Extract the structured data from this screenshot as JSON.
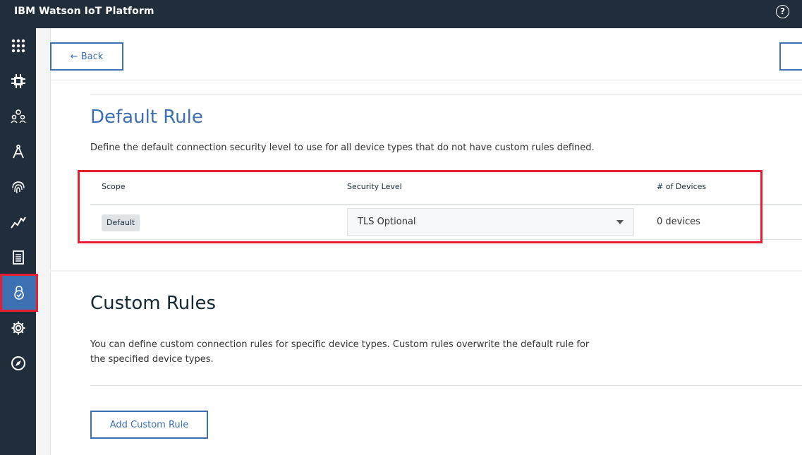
{
  "app": {
    "title": "IBM Watson IoT Platform",
    "help_icon": "help-circle-icon"
  },
  "sidebar": {
    "items": [
      {
        "name": "apps-grid",
        "icon": "grid-icon",
        "active": false
      },
      {
        "name": "devices",
        "icon": "chip-icon",
        "active": false
      },
      {
        "name": "members",
        "icon": "members-icon",
        "active": false
      },
      {
        "name": "rules",
        "icon": "compass-draw-icon",
        "active": false
      },
      {
        "name": "identity",
        "icon": "fingerprint-icon",
        "active": false
      },
      {
        "name": "usage",
        "icon": "chart-line-icon",
        "active": false
      },
      {
        "name": "logs",
        "icon": "document-icon",
        "active": false
      },
      {
        "name": "security",
        "icon": "security-lock-icon",
        "active": true
      },
      {
        "name": "settings",
        "icon": "gear-icon",
        "active": false
      },
      {
        "name": "explore",
        "icon": "compass-icon",
        "active": false
      }
    ]
  },
  "toolbar": {
    "back_label": "← Back"
  },
  "default_rule": {
    "title": "Default Rule",
    "description": "Define the default connection security level to use for all device types that do not have custom rules defined.",
    "columns": [
      "Scope",
      "Security Level",
      "# of Devices"
    ],
    "row": {
      "scope": "Default",
      "security_level": "TLS Optional",
      "devices": "0 devices"
    }
  },
  "custom_rules": {
    "title": "Custom Rules",
    "description": "You can define custom connection rules for specific device types. Custom rules overwrite the default rule for the specified device types.",
    "add_label": "Add Custom Rule"
  },
  "colors": {
    "accent": "#3d70b2",
    "nav_bg": "#1f2e3a",
    "highlight": "#e71d32"
  }
}
